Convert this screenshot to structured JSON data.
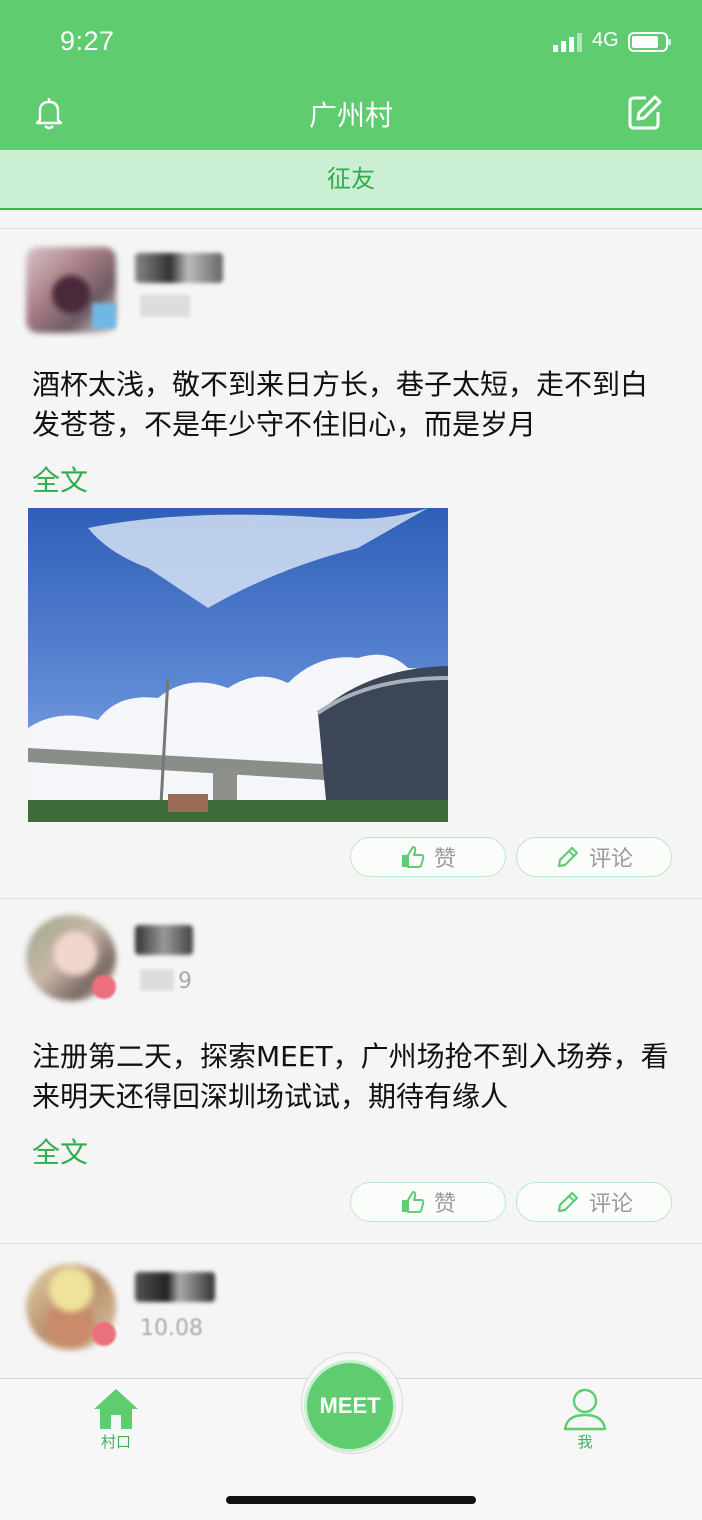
{
  "status_bar": {
    "time": "9:27",
    "network": "4G"
  },
  "header": {
    "title": "广州村",
    "subtab": "征友"
  },
  "posts": [
    {
      "meta": "",
      "text": "酒杯太浅，敬不到来日方长，巷子太短，走不到白发苍苍，不是年少守不住旧心，而是岁月",
      "full_text_label": "全文",
      "has_photo": true,
      "like_label": "赞",
      "comment_label": "评论"
    },
    {
      "meta": "9",
      "text": "注册第二天，探索MEET，广州场抢不到入场券，看来明天还得回深圳场试试，期待有缘人",
      "full_text_label": "全文",
      "has_photo": false,
      "like_label": "赞",
      "comment_label": "评论"
    },
    {
      "meta": "10.08"
    }
  ],
  "tabbar": {
    "home_label": "村口",
    "meet_label": "MEET",
    "me_label": "我"
  },
  "colors": {
    "brand_green": "#5fcc70",
    "accent_text": "#2fae4f",
    "subtab_bg": "#cbefd2"
  },
  "icons": [
    "bell-icon",
    "edit-icon",
    "thumbs-up-icon",
    "pencil-icon",
    "home-icon",
    "user-icon",
    "signal-icon",
    "battery-icon"
  ]
}
